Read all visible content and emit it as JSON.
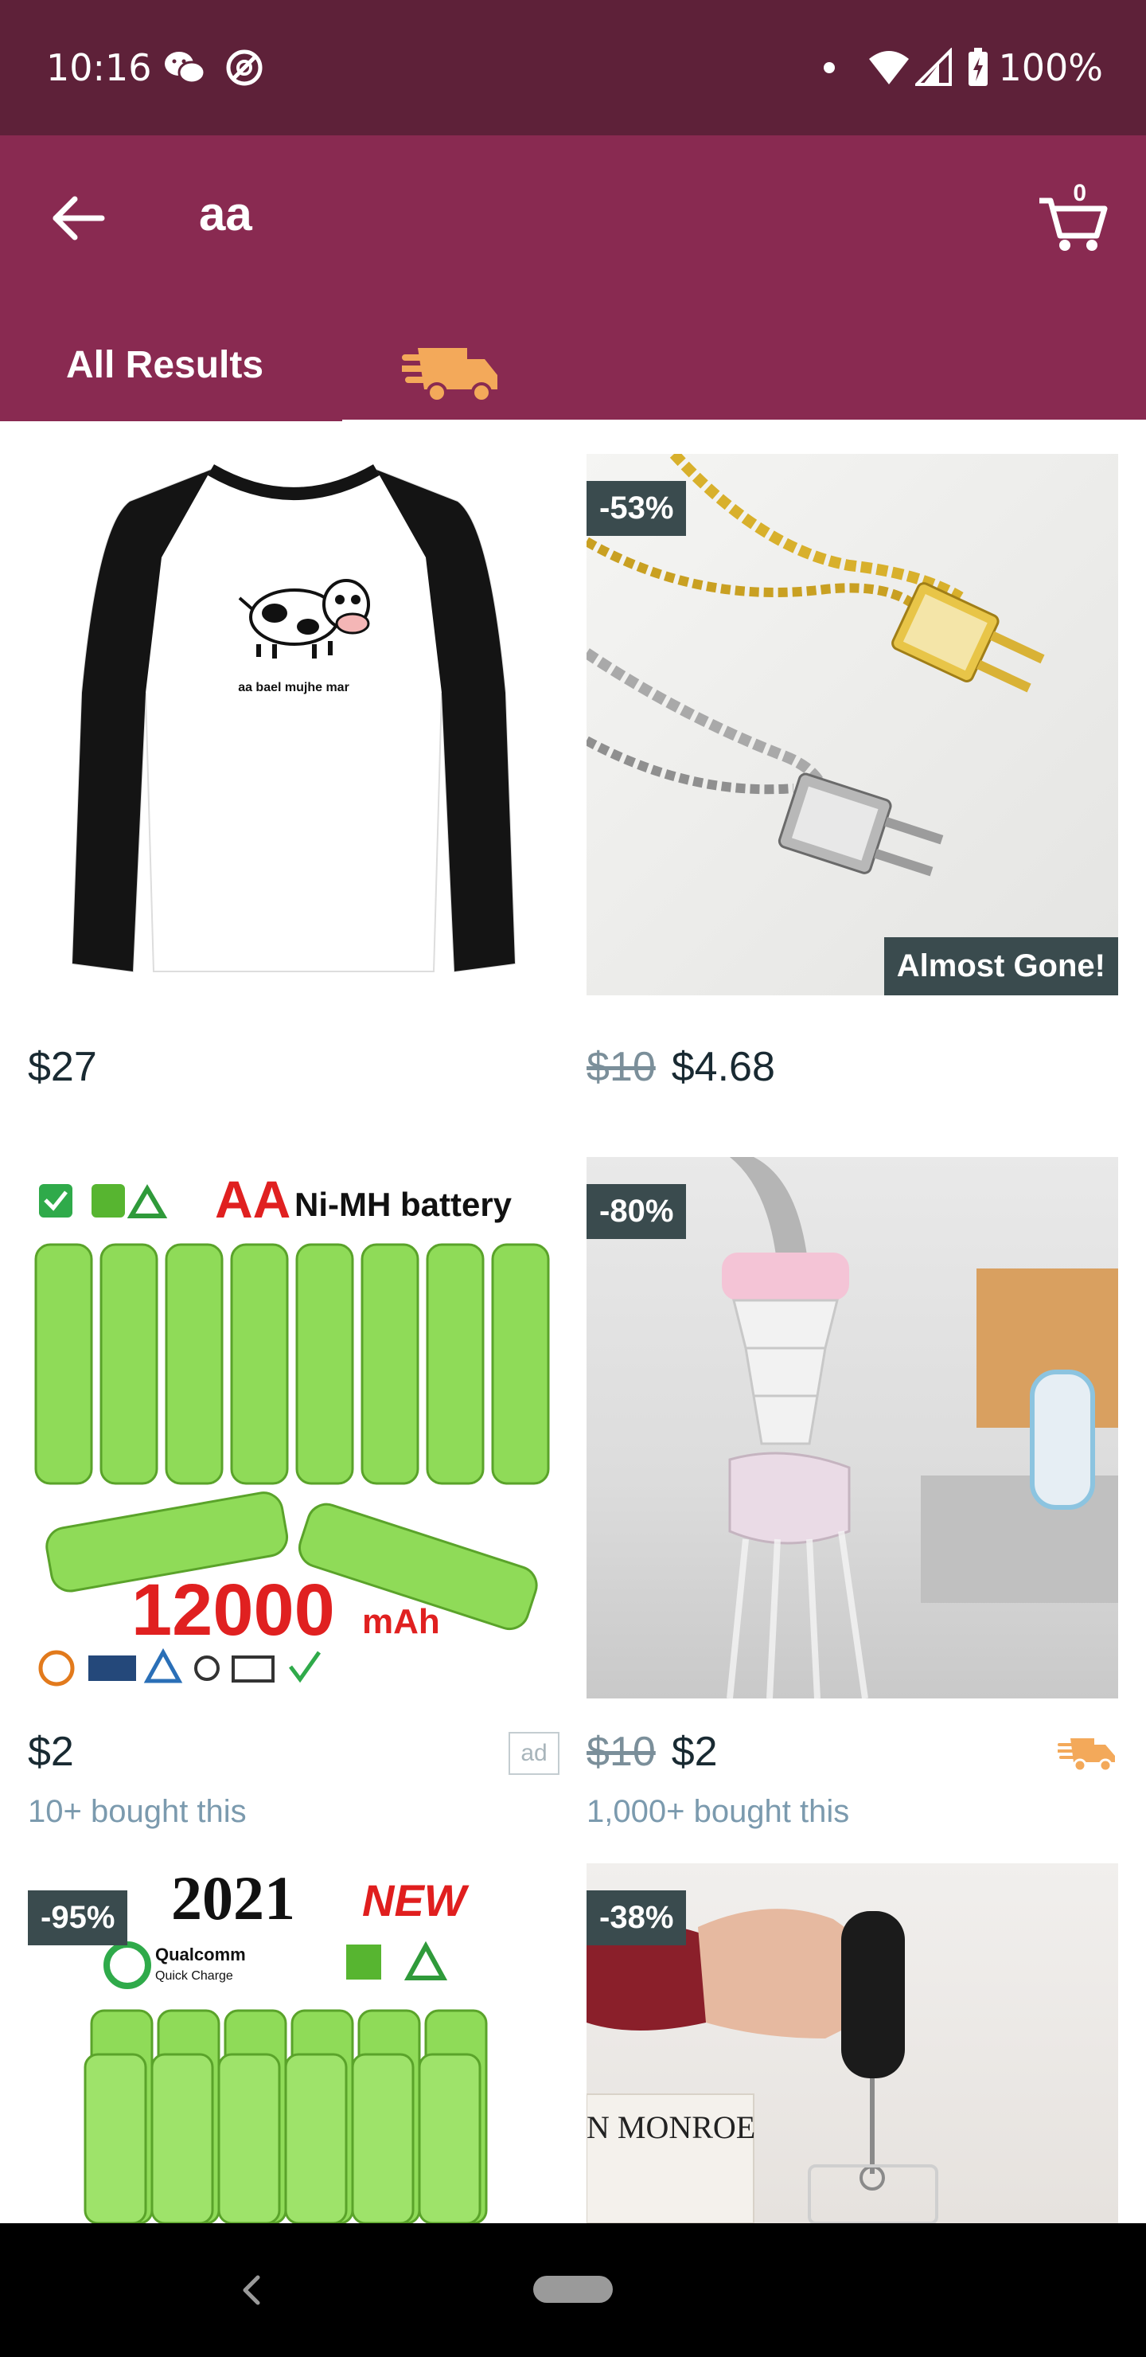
{
  "status_bar": {
    "time": "10:16",
    "battery": "100%",
    "icons": [
      "wechat-icon",
      "at-icon",
      "dot-icon",
      "wifi-icon",
      "signal-icon",
      "battery-icon"
    ]
  },
  "header": {
    "search_query": "aa",
    "cart_count": "0",
    "colors": {
      "status_bar": "#5e2139",
      "header": "#892a51"
    }
  },
  "tabs": [
    {
      "label": "All Results",
      "active": true
    },
    {
      "label": "",
      "icon": "fast-shipping-truck-icon",
      "active": false
    }
  ],
  "products": [
    {
      "price": "$27",
      "image": "shirt",
      "image_caption": "aa bael mujhe mar"
    },
    {
      "discount": "-53%",
      "old_price": "$10",
      "price": "$4.68",
      "badge": "Almost Gone!",
      "image": "plug-necklaces"
    },
    {
      "price": "$2",
      "ad_label": "ad",
      "bought": "10+ bought this",
      "image": "aa-batteries",
      "image_text": {
        "title_aa": "AA",
        "title_rest": "Ni-MH battery",
        "capacity": "12000",
        "unit": "mAh"
      }
    },
    {
      "discount": "-80%",
      "old_price": "$10",
      "price": "$2",
      "bought": "1,000+ bought this",
      "fast_shipping": true,
      "image": "faucet-filter"
    },
    {
      "discount": "-95%",
      "image": "18650-batteries",
      "image_text": {
        "year": "2021",
        "new": "NEW",
        "brand": "Qualcomm",
        "sub": "Quick Charge"
      }
    },
    {
      "discount": "-38%",
      "image": "milk-frother",
      "image_text": {
        "book": "N MONROE"
      }
    }
  ]
}
